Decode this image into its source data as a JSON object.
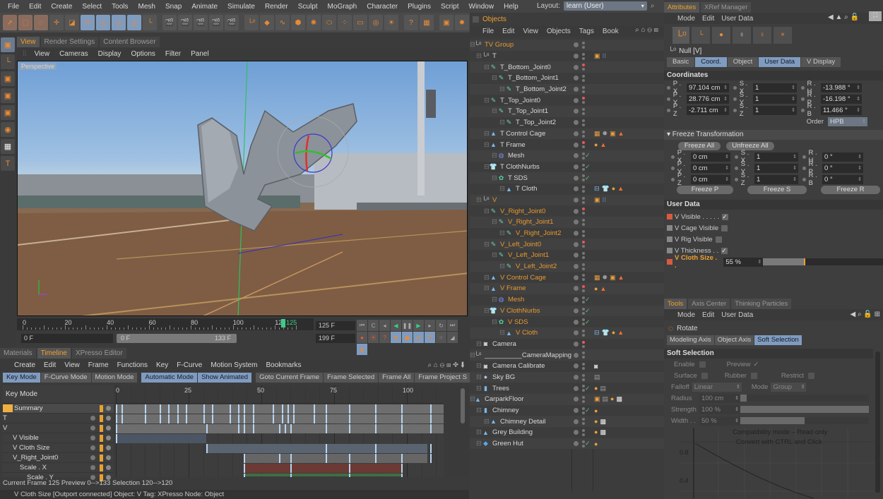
{
  "menubar": [
    "File",
    "Edit",
    "Create",
    "Select",
    "Tools",
    "Mesh",
    "Snap",
    "Animate",
    "Simulate",
    "Render",
    "Sculpt",
    "MoGraph",
    "Character",
    "Plugins",
    "Script",
    "Window",
    "Help"
  ],
  "layout": {
    "label": "Layout:",
    "value": "learn (User)"
  },
  "toolbar": {
    "icons": [
      "select-arrow-icon",
      "box-select-icon",
      "lasso-select-icon",
      "move-icon",
      "scale-icon",
      "rotate-icon",
      "x-axis-icon",
      "y-axis-icon",
      "z-axis-icon",
      "world-coord-icon",
      "clapper-render-icon",
      "clapper-region-icon",
      "clapper-active-icon",
      "clapper-edit-icon",
      "clapper-settings-icon",
      "null-icon",
      "cube-icon",
      "spline-icon",
      "nurbs-icon",
      "array-icon",
      "deformer-icon",
      "particles-icon",
      "floor-icon",
      "camera-icon",
      "light-icon",
      "help-cursor-icon",
      "xpresso-icon",
      "picture-viewer-icon",
      "sky-icon"
    ]
  },
  "leftstrip": [
    "model-mode-icon",
    "axis-mode-icon",
    "points-mode-icon",
    "edges-mode-icon",
    "polygons-mode-icon",
    "uvw-mode-icon",
    "texture-mode-icon",
    "workplane-icon"
  ],
  "viewport": {
    "tabs": [
      {
        "label": "View",
        "active": true
      },
      {
        "label": "Render Settings"
      },
      {
        "label": "Content Browser"
      }
    ],
    "menu": [
      "View",
      "Cameras",
      "Display",
      "Options",
      "Filter",
      "Panel"
    ],
    "label": "Perspective"
  },
  "timeline_ruler": {
    "ticks": [
      "0",
      "20",
      "40",
      "60",
      "80",
      "100",
      "120"
    ],
    "current": "125",
    "current_frame": "125 F",
    "start": "0 F",
    "end": "199 F",
    "range_start": "0 F",
    "range_end": "133 F"
  },
  "transport": {
    "row1": [
      "⏮",
      "C",
      "◂",
      "◀",
      "❚❚",
      "▶",
      "▸",
      "↻",
      "⏭"
    ],
    "row2": [
      "●",
      "⦿",
      "?",
      "✥",
      "◼",
      "◎",
      "P",
      "⁘",
      "◢",
      "▮"
    ]
  },
  "bottom_tabs": [
    {
      "label": "Materials"
    },
    {
      "label": "Timeline",
      "active": true
    },
    {
      "label": "XPresso Editor"
    }
  ],
  "timeline": {
    "menu": [
      "Create",
      "Edit",
      "View",
      "Frame",
      "Functions",
      "Key",
      "F-Curve",
      "Motion System",
      "Bookmarks"
    ],
    "mode_buttons": [
      {
        "label": "Key Mode",
        "on": true
      },
      {
        "label": "F-Curve Mode"
      },
      {
        "label": "Motion Mode"
      }
    ],
    "auto_buttons": [
      {
        "label": "Automatic Mode",
        "on": true
      },
      {
        "label": "Show Animated",
        "on": true
      }
    ],
    "frame_buttons": [
      {
        "label": "Goto Current Frame"
      },
      {
        "label": "Frame Selected"
      },
      {
        "label": "Frame All"
      },
      {
        "label": "Frame Project S"
      }
    ],
    "header": "Key Mode",
    "ticks": [
      "0",
      "25",
      "50",
      "75",
      "100"
    ],
    "current": "125",
    "tracks": [
      {
        "name": "Summary",
        "keys": [
          0,
          2,
          10,
          15,
          18,
          21,
          24,
          30,
          33,
          39,
          42,
          44,
          47,
          54,
          57,
          59,
          61,
          68,
          72,
          80,
          89,
          98,
          108
        ]
      },
      {
        "name": "T",
        "keys": [
          0,
          2,
          10,
          15,
          18,
          21,
          24,
          30,
          33,
          39,
          42,
          44,
          47,
          54,
          57,
          59,
          61,
          68,
          72,
          80,
          89,
          98,
          108
        ]
      },
      {
        "name": "V",
        "keys": [
          0,
          31,
          42,
          44,
          47,
          56,
          58,
          60,
          72,
          80,
          89,
          98,
          108
        ]
      },
      {
        "name": "V Visible",
        "keys": [
          0
        ]
      },
      {
        "name": "V Cloth Size",
        "keys": [
          31,
          72,
          89,
          108
        ]
      },
      {
        "name": "V_Right_Joint0",
        "keys": [
          44,
          56,
          60,
          72,
          80,
          89,
          98,
          108
        ]
      },
      {
        "name": "Scale . X",
        "keys": [
          44,
          60,
          80,
          98
        ]
      },
      {
        "name": "Scale . Y",
        "keys": [
          44,
          60,
          80,
          98
        ]
      }
    ],
    "status": "Current Frame  125  Preview  0-->133   Selection 120-->120"
  },
  "statusbar": "V Cloth Size [Outport connected] Object: V  Tag: XPresso  Node: Object",
  "objects": {
    "tab": "Objects",
    "menu": [
      "File",
      "Edit",
      "View",
      "Objects",
      "Tags",
      "Book"
    ],
    "rows": [
      {
        "name": "TV Group",
        "depth": 0,
        "icon": "null",
        "orange": true,
        "tags": []
      },
      {
        "name": "T",
        "depth": 1,
        "icon": "null",
        "tags": [
          "display",
          "dots"
        ]
      },
      {
        "name": "T_Bottom_Joint0",
        "depth": 2,
        "icon": "joint",
        "red": true,
        "tags": []
      },
      {
        "name": "T_Bottom_Joint1",
        "depth": 3,
        "icon": "joint",
        "tags": []
      },
      {
        "name": "T_Bottom_Joint2",
        "depth": 4,
        "icon": "joint",
        "tags": []
      },
      {
        "name": "T_Top_Joint0",
        "depth": 2,
        "icon": "joint",
        "red": true,
        "tags": []
      },
      {
        "name": "T_Top_Joint1",
        "depth": 3,
        "icon": "joint",
        "tags": []
      },
      {
        "name": "T_Top_Joint2",
        "depth": 4,
        "icon": "joint",
        "tags": []
      },
      {
        "name": "T Control Cage",
        "depth": 2,
        "icon": "poly",
        "tags": [
          "xpresso",
          "weight",
          "display",
          "cone"
        ]
      },
      {
        "name": "T Frame",
        "depth": 2,
        "icon": "poly",
        "red": true,
        "tags": [
          "material",
          "cone"
        ]
      },
      {
        "name": "Mesh",
        "depth": 3,
        "icon": "mesh",
        "check": true,
        "tags": []
      },
      {
        "name": "T ClothNurbs",
        "depth": 2,
        "icon": "cloth",
        "check": true,
        "tags": []
      },
      {
        "name": "T SDS",
        "depth": 3,
        "icon": "sds",
        "check": true,
        "tags": []
      },
      {
        "name": "T Cloth",
        "depth": 4,
        "icon": "poly",
        "tags": [
          "cloth-tag",
          "shirt",
          "material",
          "cone"
        ]
      },
      {
        "name": "V",
        "depth": 1,
        "icon": "null",
        "orange": true,
        "tags": [
          "display",
          "dots"
        ]
      },
      {
        "name": "V_Right_Joint0",
        "depth": 2,
        "icon": "joint",
        "orange": true,
        "red": true,
        "tags": []
      },
      {
        "name": "V_Right_Joint1",
        "depth": 3,
        "icon": "joint",
        "orange": true,
        "tags": []
      },
      {
        "name": "V_Right_Joint2",
        "depth": 4,
        "icon": "joint",
        "orange": true,
        "tags": []
      },
      {
        "name": "V_Left_Joint0",
        "depth": 2,
        "icon": "joint",
        "orange": true,
        "red": true,
        "tags": []
      },
      {
        "name": "V_Left_Joint1",
        "depth": 3,
        "icon": "joint",
        "orange": true,
        "tags": []
      },
      {
        "name": "V_Left_Joint2",
        "depth": 4,
        "icon": "joint",
        "orange": true,
        "tags": []
      },
      {
        "name": "V Control Cage",
        "depth": 2,
        "icon": "poly",
        "orange": true,
        "tags": [
          "xpresso",
          "weight",
          "display",
          "cone"
        ]
      },
      {
        "name": "V Frame",
        "depth": 2,
        "icon": "poly",
        "orange": true,
        "red": true,
        "tags": [
          "material",
          "cone"
        ]
      },
      {
        "name": "Mesh",
        "depth": 3,
        "icon": "mesh",
        "orange": true,
        "check": true,
        "tags": []
      },
      {
        "name": "V ClothNurbs",
        "depth": 2,
        "icon": "cloth",
        "orange": true,
        "check": true,
        "tags": []
      },
      {
        "name": "V SDS",
        "depth": 3,
        "icon": "sds",
        "orange": true,
        "check": true,
        "tags": []
      },
      {
        "name": "V Cloth",
        "depth": 4,
        "icon": "poly",
        "orange": true,
        "tags": [
          "cloth-tag",
          "shirt",
          "material",
          "cone"
        ]
      },
      {
        "name": "Camera",
        "depth": 1,
        "icon": "camera",
        "red": true,
        "tags": []
      },
      {
        "name": "__________CameraMapping",
        "depth": 0,
        "icon": "null",
        "tags": []
      },
      {
        "name": "Camera Calibrate",
        "depth": 1,
        "icon": "camera",
        "tags": [
          "camera-tag"
        ]
      },
      {
        "name": "Sky BG",
        "depth": 1,
        "icon": "sky",
        "tags": [
          "texture"
        ]
      },
      {
        "name": "Trees",
        "depth": 1,
        "icon": "cyl",
        "check": true,
        "tags": [
          "material",
          "texture"
        ]
      },
      {
        "name": "CarparkFloor",
        "depth": 0,
        "icon": "poly",
        "tags": [
          "display",
          "texture",
          "material",
          "checker"
        ]
      },
      {
        "name": "Chimney",
        "depth": 1,
        "icon": "cyl",
        "check": true,
        "tags": [
          "material"
        ]
      },
      {
        "name": "Chimney Detail",
        "depth": 2,
        "icon": "poly",
        "tags": [
          "material",
          "checker"
        ]
      },
      {
        "name": "Grey Building",
        "depth": 1,
        "icon": "poly",
        "tags": [
          "material",
          "checker"
        ]
      },
      {
        "name": "Green Hut",
        "depth": 1,
        "icon": "cube",
        "check": true,
        "tags": [
          "material"
        ]
      }
    ]
  },
  "attributes": {
    "tabs": [
      {
        "label": "Attributes",
        "active": true
      },
      {
        "label": "XRef Manager"
      }
    ],
    "menu": [
      "Mode",
      "Edit",
      "User Data"
    ],
    "object_name": "Null [V]",
    "sub_tabs": [
      {
        "label": "Basic"
      },
      {
        "label": "Coord.",
        "on": true
      },
      {
        "label": "Object"
      },
      {
        "label": "User Data",
        "on": true
      },
      {
        "label": "V Display"
      }
    ],
    "coordinates_title": "Coordinates",
    "coords": [
      {
        "p_label": "P . X",
        "p": "97.104 cm",
        "s_label": "S . X",
        "s": "1",
        "r_label": "R . H",
        "r": "-13.988 °"
      },
      {
        "p_label": "P . Y",
        "p": "28.776 cm",
        "s_label": "S . Y",
        "s": "1",
        "r_label": "R . P",
        "r": "-16.198 °"
      },
      {
        "p_label": "P . Z",
        "p": "-2.711 cm",
        "s_label": "S . Z",
        "s": "1",
        "r_label": "R . B",
        "r": "11.466 °"
      }
    ],
    "order_label": "Order",
    "order_value": "HPB",
    "freeze_title": "▾ Freeze Transformation",
    "freeze_all": "Freeze All",
    "unfreeze_all": "Unfreeze All",
    "freeze_coords": [
      {
        "p_label": "P . X",
        "p": "0 cm",
        "s_label": "S . X",
        "s": "1",
        "r_label": "R . H",
        "r": "0 °"
      },
      {
        "p_label": "P . Y",
        "p": "0 cm",
        "s_label": "S . Y",
        "s": "1",
        "r_label": "R . P",
        "r": "0 °"
      },
      {
        "p_label": "P . Z",
        "p": "0 cm",
        "s_label": "S . Z",
        "s": "1",
        "r_label": "R . B",
        "r": "0 °"
      }
    ],
    "freeze_p": "Freeze P",
    "freeze_s": "Freeze S",
    "freeze_r": "Freeze R",
    "userdata_title": "User Data",
    "userdata": [
      {
        "label": "V Visible . . . . .",
        "checked": true,
        "red": true
      },
      {
        "label": "V Cage Visible",
        "checked": false
      },
      {
        "label": "V Rig Visible",
        "checked": false
      },
      {
        "label": "V Thickness . .",
        "checked": true
      },
      {
        "label": "V Cloth Size . .",
        "value": "55 %",
        "slider": 0.55,
        "red": true,
        "orange": true
      }
    ]
  },
  "tools": {
    "tabs": [
      {
        "label": "Tools",
        "active": true
      },
      {
        "label": "Axis Center"
      },
      {
        "label": "Thinking Particles"
      }
    ],
    "menu": [
      "Mode",
      "Edit",
      "User Data"
    ],
    "tool_name": "Rotate",
    "sub_tabs": [
      {
        "label": "Modeling Axis"
      },
      {
        "label": "Object Axis"
      },
      {
        "label": "Soft Selection",
        "on": true
      }
    ],
    "soft_title": "Soft Selection",
    "enable": "Enable",
    "preview": "Preview",
    "surface": "Surface",
    "rubber": "Rubber",
    "restrict": "Restrict",
    "falloff_label": "Falloff",
    "falloff": "Linear",
    "mode_label": "Mode",
    "mode": "Group",
    "radius_label": "Radius",
    "radius": "100 cm",
    "radius_frac": 0.05,
    "strength_label": "Strength",
    "strength": "100 %",
    "strength_frac": 1.0,
    "width_label": "Width . .",
    "width": "50 %",
    "width_frac": 0.5,
    "graph_note1": "Compatibility mode – Read only",
    "graph_note2": "Convert with CTRL and Click",
    "graph_ticks": [
      "0.8",
      "0.4"
    ]
  }
}
